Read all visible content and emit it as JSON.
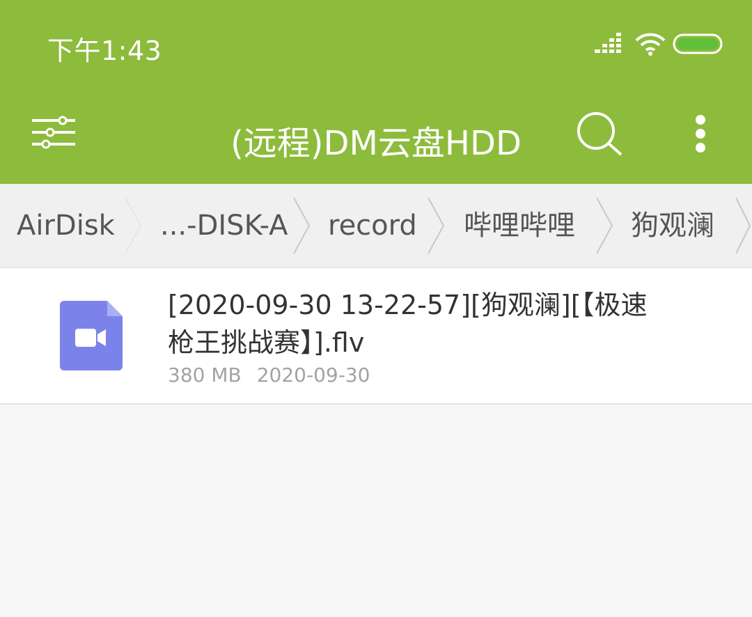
{
  "status_bar": {
    "time": "下午1:43",
    "icons": [
      "signal-icon",
      "wifi-icon",
      "battery-icon"
    ]
  },
  "toolbar": {
    "title": "(远程)DM云盘HDD",
    "icons": [
      "sliders-menu-icon",
      "search-icon",
      "more-vert-icon"
    ]
  },
  "breadcrumb": {
    "items": [
      "AirDisk",
      "...-DISK-A",
      "record",
      "哔哩哔哩",
      "狗观澜"
    ]
  },
  "files": [
    {
      "name_lines": [
        "[2020-09-30 13-22-57][狗观澜][【极速",
        "枪王挑战赛】].flv"
      ],
      "size": "380 MB",
      "date": "2020-09-30",
      "icon": "video-file-icon"
    }
  ],
  "colors": {
    "accent": "#8dbb3c",
    "file_icon": "#7b83eb",
    "background": "#f7f7f7"
  }
}
